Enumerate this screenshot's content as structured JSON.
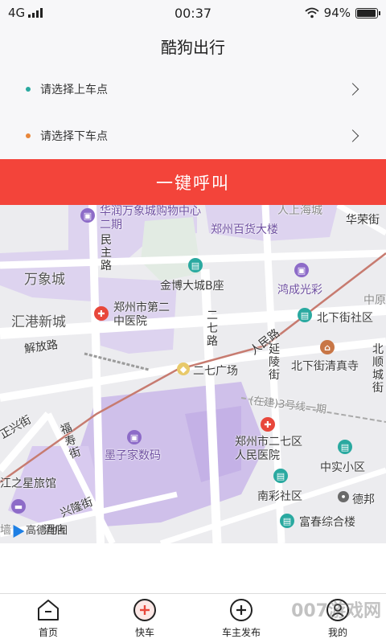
{
  "status_bar": {
    "network": "4G",
    "time": "00:37",
    "battery": "94%",
    "battery_level": 0.94
  },
  "header": {
    "title": "酷狗出行"
  },
  "pickup": {
    "label": "请选择上车点",
    "dot_color": "#2aa9a0"
  },
  "dropoff": {
    "label": "请选择下车点",
    "dot_color": "#e8873b"
  },
  "call_button": {
    "label": "一键呼叫",
    "color": "#f3443a"
  },
  "map": {
    "provider": "高德地图",
    "labels": {
      "huarun": "华润万象城购物中心二期",
      "renmin_shang": "人上海城",
      "huarong": "华荣街",
      "baihuo": "郑州百货大楼",
      "wanxiang": "万象城",
      "minzhu": "民主路",
      "jinbo": "金博大城B座",
      "hongcheng": "鸿成光彩",
      "zhongyuan": "中原",
      "huigang": "汇港新城",
      "dier_hosp": "郑州市第二中医院",
      "beixiajie": "北下街社区",
      "erqi_lu": "二七路",
      "renmin_lu": "人民路",
      "jiefang": "解放路",
      "yanling": "延陵街",
      "beixiajie_mosque": "北下街清真寺",
      "beishun": "北顺城街",
      "erqi_square": "二七广场",
      "line3": "(在建)3号线一期",
      "xingjie": "正兴街",
      "fushou": "福寿街",
      "mozi": "墨子家数码",
      "erqi_hosp": "郑州市二七区人民医院",
      "zhongshi": "中实小区",
      "jiangzhixing": "江之星旅馆",
      "xinglong": "兴隆街",
      "nancai": "南彩社区",
      "debang": "德邦",
      "fuchun": "富春综合楼",
      "hotel": "酒店",
      "qiang": "墙"
    }
  },
  "tabs": [
    {
      "label": "首页",
      "icon": "home-icon"
    },
    {
      "label": "快车",
      "icon": "plus-circle-icon"
    },
    {
      "label": "车主发布",
      "icon": "plus-circle-icon"
    },
    {
      "label": "我的",
      "icon": "user-icon"
    }
  ],
  "watermark": "007游戏网"
}
